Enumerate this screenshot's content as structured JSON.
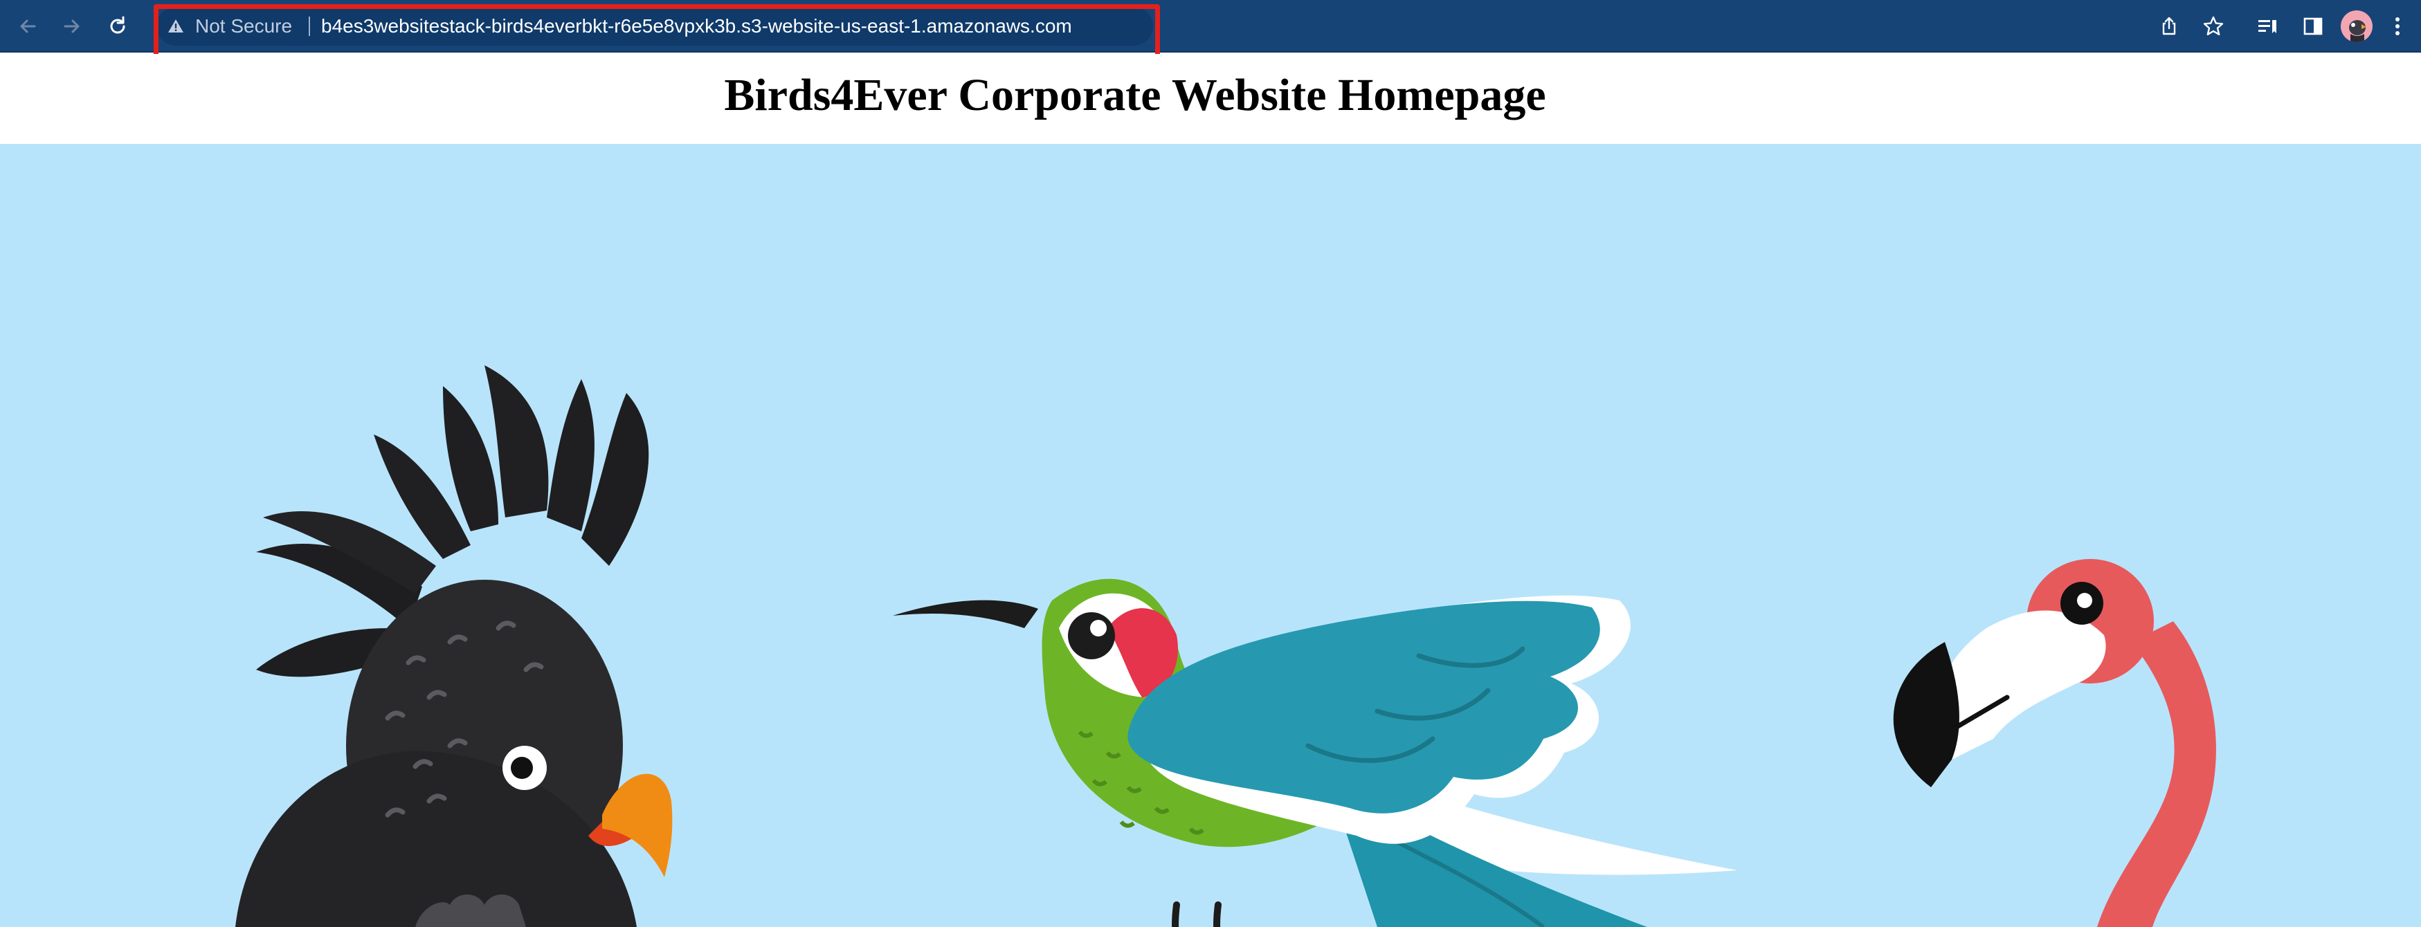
{
  "browser": {
    "security_label": "Not Secure",
    "url": "b4es3websitestack-birds4everbkt-r6e5e8vpxk3b.s3-website-us-east-1.amazonaws.com",
    "icons": {
      "back": "arrow-left-icon",
      "forward": "arrow-right-icon",
      "reload": "reload-icon",
      "warning": "warning-triangle-icon",
      "share": "share-icon",
      "bookmark": "star-icon",
      "reading_list": "reading-list-icon",
      "side_panel": "side-panel-icon",
      "profile": "profile-avatar",
      "menu": "kebab-menu-icon"
    },
    "colors": {
      "toolbar": "#174477",
      "omnibox": "#0f3a6a",
      "highlight": "#e2211c"
    }
  },
  "page": {
    "title": "Birds4Ever Corporate Website Homepage",
    "hero": {
      "background": "#b8e4fb",
      "illustration": [
        "black-cockatoo",
        "hummingbird",
        "flamingo"
      ]
    }
  }
}
